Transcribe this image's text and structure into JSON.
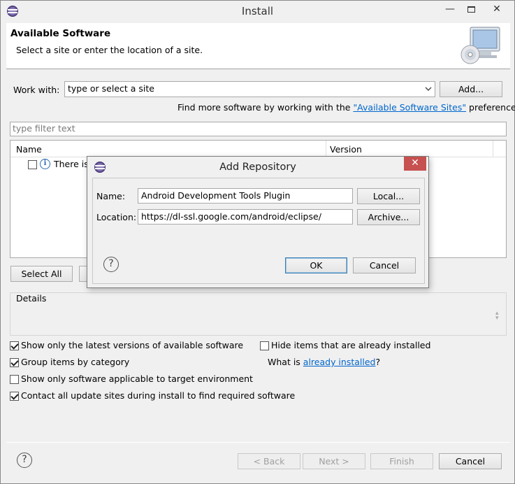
{
  "window": {
    "title": "Install"
  },
  "banner": {
    "title": "Available Software",
    "subtitle": "Select a site or enter the location of a site."
  },
  "work_with": {
    "label": "Work with:",
    "placeholder": "type or select a site",
    "add_label": "Add...",
    "find_more_prefix": "Find more software by working with the ",
    "find_more_link": "\"Available Software Sites\"",
    "find_more_suffix": " preferences."
  },
  "filter": {
    "placeholder": "type filter text"
  },
  "table": {
    "columns": [
      "Name",
      "Version"
    ],
    "rows": [
      {
        "name": "There is",
        "checked": false
      }
    ]
  },
  "buttons": {
    "select_all": "Select All"
  },
  "details": {
    "label": "Details"
  },
  "options": {
    "latest_versions": {
      "label": "Show only the latest versions of available software",
      "checked": true
    },
    "hide_installed": {
      "label": "Hide items that are already installed",
      "checked": false
    },
    "group_by_category": {
      "label": "Group items by category",
      "checked": true
    },
    "what_is_prefix": "What is ",
    "what_is_link": "already installed",
    "what_is_suffix": "?",
    "target_env": {
      "label": "Show only software applicable to target environment",
      "checked": false
    },
    "contact_sites": {
      "label": "Contact all update sites during install to find required software",
      "checked": true
    }
  },
  "footer": {
    "back": "< Back",
    "next": "Next >",
    "finish": "Finish",
    "cancel": "Cancel"
  },
  "dialog": {
    "title": "Add Repository",
    "name_label": "Name:",
    "name_value": "Android Development Tools Plugin",
    "local_label": "Local...",
    "location_label": "Location:",
    "location_value": "https://dl-ssl.google.com/android/eclipse/",
    "archive_label": "Archive...",
    "ok_label": "OK",
    "cancel_label": "Cancel"
  },
  "colors": {
    "link": "#0066cc",
    "close_red": "#c75050"
  }
}
